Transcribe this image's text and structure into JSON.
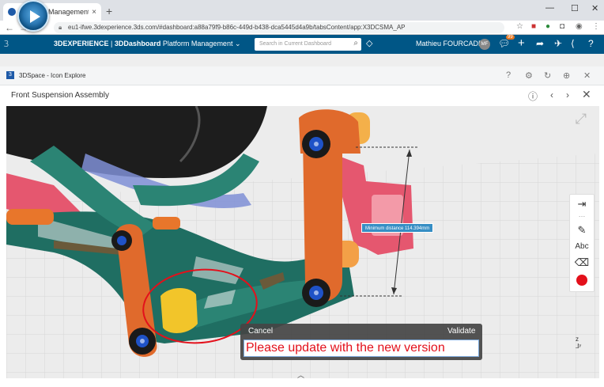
{
  "browser": {
    "tab_title": "Platform Management - Content",
    "tab_close": "×",
    "new_tab": "+",
    "minimize": "—",
    "maximize": "☐",
    "close": "✕",
    "url": "eu1-ifwe.3dexperience.3ds.com/#dashboard:a88a79f9-b86c-449d-b438-dca5445d4a9b/tabsContent/app:X3DCSMA_AP",
    "icons": [
      "back-icon",
      "forward-icon",
      "reload-icon",
      "home-icon",
      "lock-icon",
      "star-icon",
      "extension-icon",
      "profile-icon",
      "menu-icon"
    ]
  },
  "dashboard": {
    "brand_prefix": "3DEXPERIENCE",
    "brand_separator": " | ",
    "brand_app": "3DDashboard",
    "dashboard_name": "Platform Management",
    "search_placeholder": "Search in Current Dashboard",
    "user_name": "Mathieu FOURCADE",
    "user_initials": "MF",
    "notification_count": "99",
    "colors": {
      "bar": "#005686",
      "accent": "#368ec4"
    }
  },
  "widget": {
    "title": "3DSpace - Icon Explore",
    "icons": [
      "help-icon",
      "settings-icon",
      "refresh-icon",
      "export-icon",
      "close-icon"
    ]
  },
  "panel": {
    "title": "Front Suspension Assembly"
  },
  "viewer": {
    "measurement_label": "Minimum distance 114.394mm",
    "tools": [
      "exit-icon",
      "pen-icon",
      "text-icon",
      "eraser-icon",
      "color-icon"
    ],
    "text_tool_label": "Abc",
    "annotation_color": "#e3101b"
  },
  "annotation_popup": {
    "cancel": "Cancel",
    "validate": "Validate",
    "note": "Please update with the new version"
  }
}
